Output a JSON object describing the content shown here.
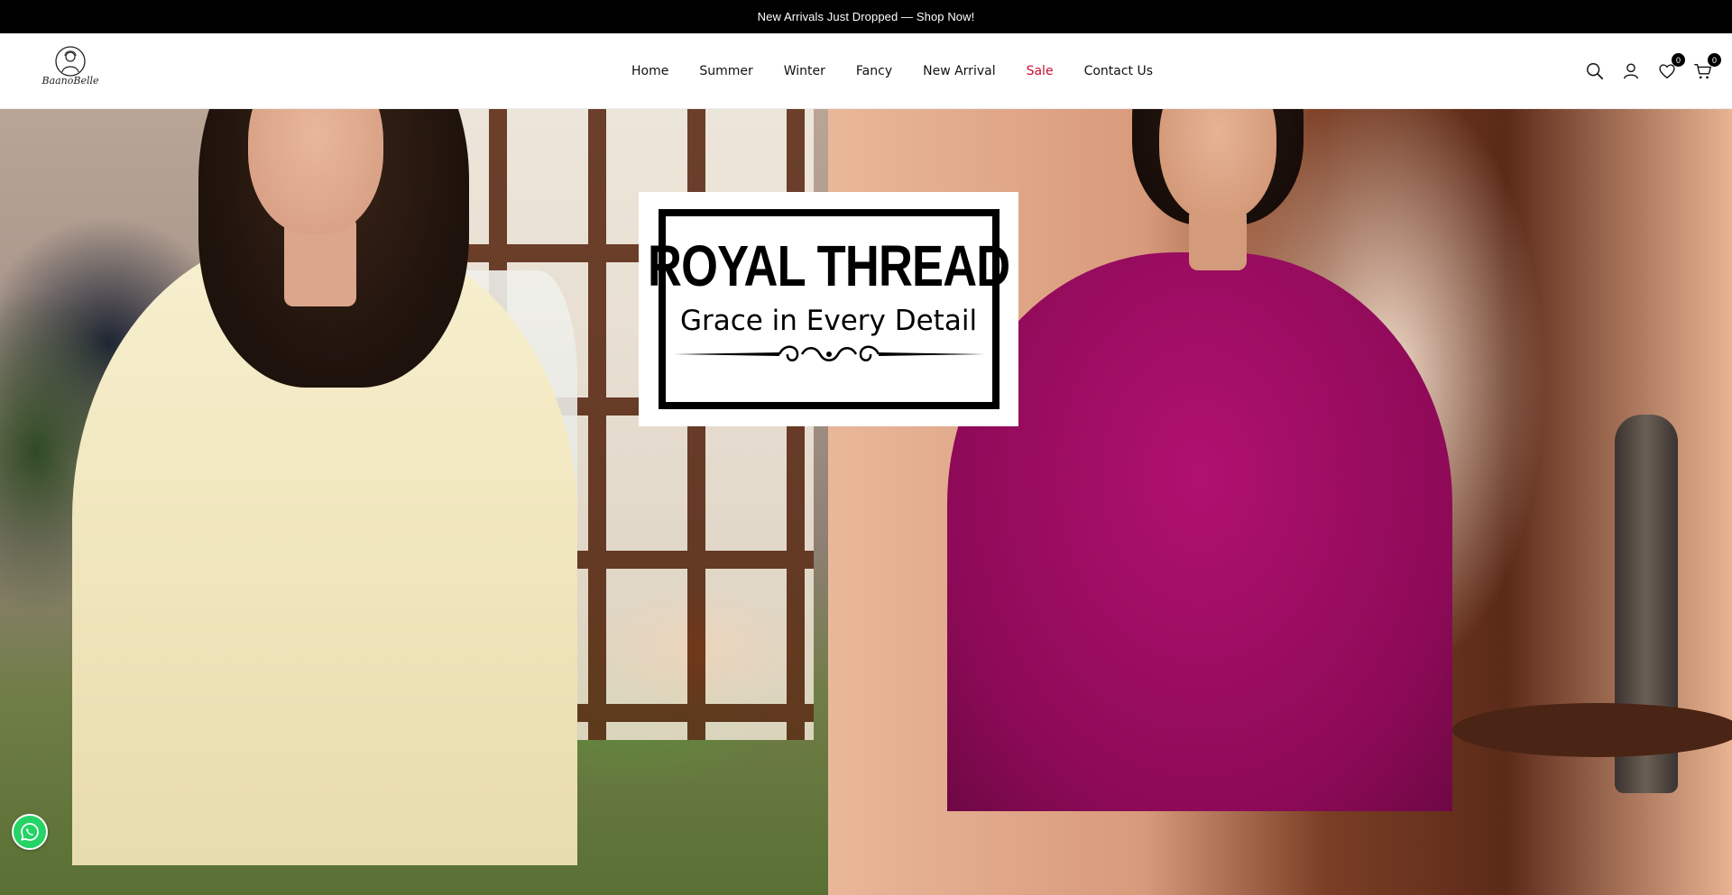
{
  "announcement": {
    "text": "New Arrivals Just Dropped — Shop Now!"
  },
  "brand": {
    "name": "BaanoBelle"
  },
  "nav": {
    "items": [
      {
        "label": "Home"
      },
      {
        "label": "Summer"
      },
      {
        "label": "Winter"
      },
      {
        "label": "Fancy"
      },
      {
        "label": "New Arrival"
      },
      {
        "label": "Sale"
      },
      {
        "label": "Contact Us"
      }
    ]
  },
  "header_icons": {
    "search": "search-icon",
    "account": "user-icon",
    "wishlist": "heart-icon",
    "wishlist_count": "0",
    "cart": "cart-icon",
    "cart_count": "0"
  },
  "hero": {
    "promo_title": "ROYAL THREAD",
    "promo_subtitle": "Grace in Every Detail"
  },
  "colors": {
    "announcement_bg": "#000000",
    "sale": "#c8102e",
    "whatsapp": "#25d366"
  },
  "whatsapp": {
    "icon": "whatsapp-icon"
  }
}
